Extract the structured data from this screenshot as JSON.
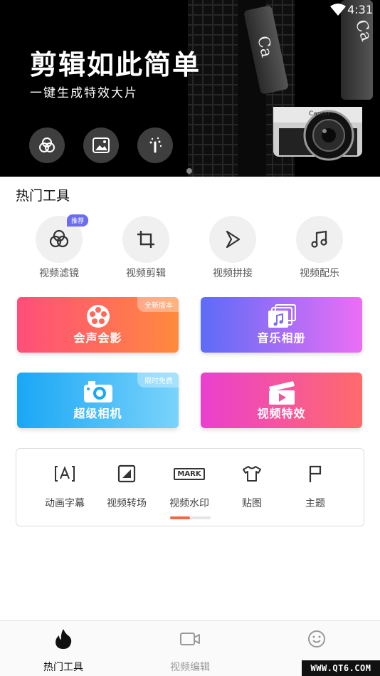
{
  "status_bar": {
    "time": "4:31"
  },
  "banner": {
    "title": "剪辑如此简单",
    "subtitle": "一键生成特效大片",
    "buttons": [
      "filter-icon",
      "image-icon",
      "magic-wand-icon"
    ]
  },
  "hot_tools": {
    "title": "热门工具",
    "items": [
      {
        "label": "视频滤镜",
        "icon": "filter-icon",
        "badge": "推荐"
      },
      {
        "label": "视频剪辑",
        "icon": "crop-icon"
      },
      {
        "label": "视频拼接",
        "icon": "play-outline-icon"
      },
      {
        "label": "视频配乐",
        "icon": "music-note-icon"
      }
    ]
  },
  "cards": [
    {
      "label": "会声会影",
      "badge": "全新版本",
      "icon": "film-reel-icon",
      "colors": [
        "#ff4e7a",
        "#ff8a3d"
      ]
    },
    {
      "label": "音乐相册",
      "icon": "album-icon",
      "colors": [
        "#5d6cf7",
        "#ec6ef5"
      ]
    },
    {
      "label": "超级相机",
      "badge": "限时免费",
      "icon": "camera-icon",
      "colors": [
        "#1aa7f5",
        "#7ad3fb"
      ]
    },
    {
      "label": "视频特效",
      "icon": "clapper-icon",
      "colors": [
        "#ea3fd0",
        "#ff6b6b"
      ]
    }
  ],
  "more_tools": [
    {
      "label": "动画字幕",
      "icon": "text-a-icon"
    },
    {
      "label": "视频转场",
      "icon": "transition-icon"
    },
    {
      "label": "视频水印",
      "icon": "mark-icon",
      "icon_text": "MARK"
    },
    {
      "label": "贴图",
      "icon": "tshirt-icon"
    },
    {
      "label": "主题",
      "icon": "flag-icon"
    }
  ],
  "bottom_nav": [
    {
      "label": "热门工具",
      "icon": "flame-icon",
      "active": true
    },
    {
      "label": "视频编辑",
      "icon": "video-camera-icon",
      "active": false
    },
    {
      "label": "",
      "icon": "smiley-icon",
      "active": false
    }
  ],
  "watermark": "WWW.QT6.COM",
  "colors": {
    "accent": "#f16a3f",
    "active_nav": "#111111",
    "inactive_nav": "#999999"
  }
}
